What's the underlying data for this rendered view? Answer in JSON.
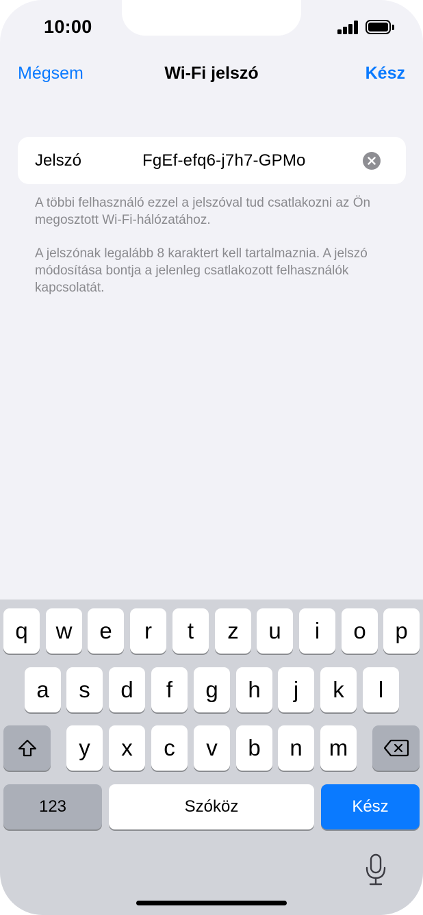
{
  "status_bar": {
    "time": "10:00"
  },
  "nav": {
    "cancel_label": "Mégsem",
    "title": "Wi-Fi jelszó",
    "done_label": "Kész"
  },
  "password_field": {
    "label": "Jelszó",
    "value": "FgEf-efq6-j7h7-GPMo"
  },
  "footnotes": [
    "A többi felhasználó ezzel a jelszóval tud csatlakozni az Ön megosztott Wi-Fi-hálózatához.",
    "A jelszónak legalább 8 karaktert kell tartalmaznia. A jelszó módosítása bontja a jelenleg csatlakozott felhasználók kapcsolatát."
  ],
  "keyboard": {
    "row1": [
      "q",
      "w",
      "e",
      "r",
      "t",
      "z",
      "u",
      "i",
      "o",
      "p"
    ],
    "row2": [
      "a",
      "s",
      "d",
      "f",
      "g",
      "h",
      "j",
      "k",
      "l"
    ],
    "row3": [
      "y",
      "x",
      "c",
      "v",
      "b",
      "n",
      "m"
    ],
    "numbers_label": "123",
    "space_label": "Szóköz",
    "return_label": "Kész",
    "icons": {
      "shift": "shift-icon",
      "delete": "delete-icon",
      "dictation": "microphone-icon"
    }
  },
  "colors": {
    "accent": "#0a7aff",
    "background": "#f2f2f7",
    "keyboard_bg": "#d1d3d9"
  }
}
